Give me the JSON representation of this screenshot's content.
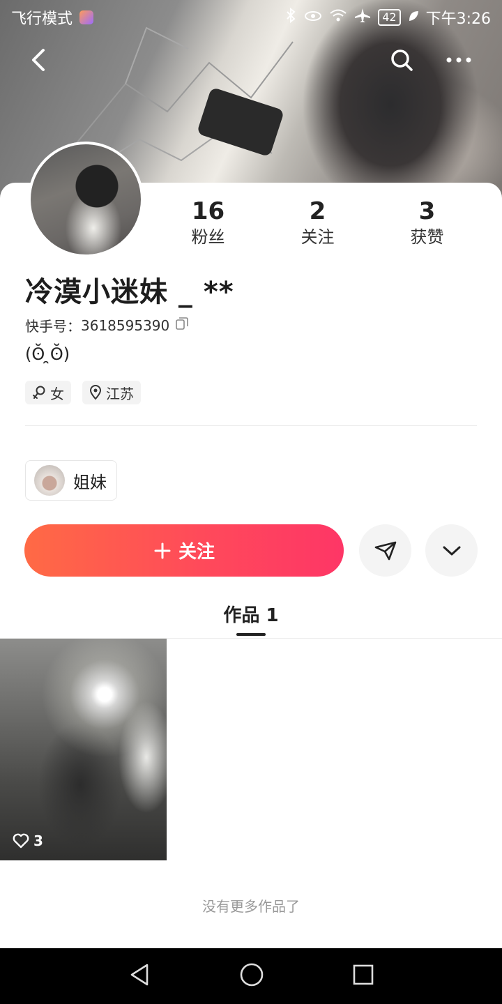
{
  "status_bar": {
    "left_text": "飞行模式",
    "battery": "42",
    "time": "下午3:26"
  },
  "profile": {
    "stats": [
      {
        "value": "16",
        "label": "粉丝"
      },
      {
        "value": "2",
        "label": "关注"
      },
      {
        "value": "3",
        "label": "获赞"
      }
    ],
    "username": "冷漠小迷妹 _ **",
    "id_label": "快手号：",
    "id_value": "3618595390",
    "bio": "(ʘ̆ ̯ʘ̆)",
    "tags": [
      {
        "icon": "female-icon",
        "label": "女"
      },
      {
        "icon": "location-pin-icon",
        "label": "江苏"
      }
    ],
    "group_chip": {
      "label": "姐妹"
    }
  },
  "actions": {
    "follow_label": "关注"
  },
  "tabs": {
    "works_label": "作品 1"
  },
  "works": [
    {
      "likes": "3"
    }
  ],
  "footer": {
    "no_more": "没有更多作品了"
  },
  "colors": {
    "follow_gradient_start": "#ff6a45",
    "follow_gradient_end": "#fe3666"
  }
}
